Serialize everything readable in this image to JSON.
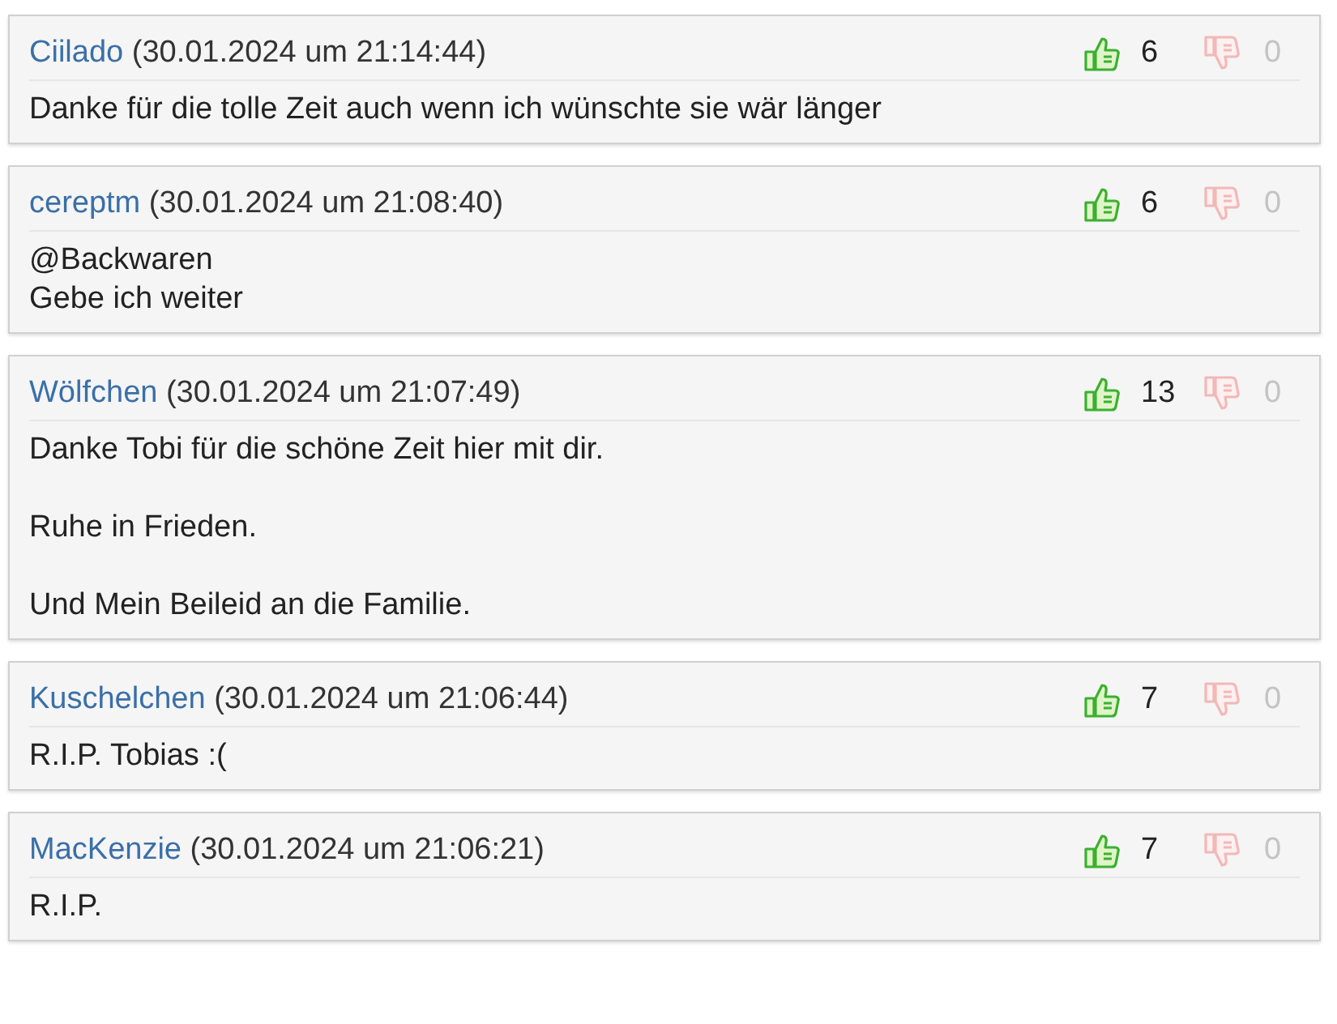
{
  "comments": [
    {
      "author": "Ciilado",
      "date": "(30.01.2024 um 21:14:44)",
      "likes": "6",
      "dislikes": "0",
      "paragraphs": [
        "Danke für die tolle Zeit auch wenn ich wünschte sie wär länger"
      ]
    },
    {
      "author": "cereptm",
      "date": "(30.01.2024 um 21:08:40)",
      "likes": "6",
      "dislikes": "0",
      "paragraphs": [
        "@Backwaren\nGebe ich weiter"
      ]
    },
    {
      "author": "Wölfchen",
      "date": "(30.01.2024 um 21:07:49)",
      "likes": "13",
      "dislikes": "0",
      "paragraphs": [
        "Danke Tobi für die schöne Zeit hier mit dir.",
        "Ruhe in Frieden.",
        "Und Mein Beileid an die Familie."
      ]
    },
    {
      "author": "Kuschelchen",
      "date": "(30.01.2024 um 21:06:44)",
      "likes": "7",
      "dislikes": "0",
      "paragraphs": [
        "R.I.P. Tobias :("
      ]
    },
    {
      "author": "MacKenzie",
      "date": "(30.01.2024 um 21:06:21)",
      "likes": "7",
      "dislikes": "0",
      "paragraphs": [
        "R.I.P."
      ]
    }
  ]
}
